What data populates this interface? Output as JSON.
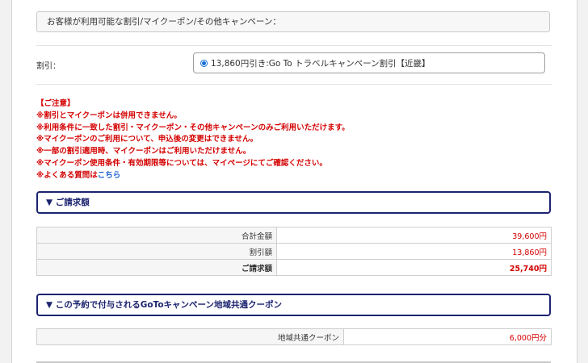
{
  "campaign_header": "お客様が利用可能な割引/マイクーポン/その他キャンペーン：",
  "discount": {
    "label": "割引：",
    "selected_option": "13,860円引き:Go To トラベルキャンペーン割引【近畿】"
  },
  "notes": {
    "title": "【ご注意】",
    "lines": [
      "※割引とマイクーポンは併用できません。",
      "※利用条件に一致した割引・マイクーポン・その他キャンペーンのみご利用いただけます。",
      "※マイクーポンのご利用について、申込後の変更はできません。",
      "※一部の割引適用時、マイクーポンはご利用いただけません。",
      "※マイクーポン使用条件・有効期限等については、マイページにてご確認ください。"
    ],
    "faq_prefix": "※よくある質問は",
    "faq_link": "こちら"
  },
  "billing": {
    "header": "▼ ご請求額",
    "rows": [
      {
        "label": "合計金額",
        "value": "39,600円"
      },
      {
        "label": "割引額",
        "value": "13,860円"
      },
      {
        "label": "ご請求額",
        "value": "25,740円"
      }
    ]
  },
  "coupon": {
    "header": "▼ この予約で付与されるGoToキャンペーン地域共通クーポン",
    "label": "地域共通クーポン",
    "value": "6,000円分"
  },
  "colors": {
    "accent_navy": "#1c2470",
    "warning_red": "#d40000",
    "link_blue": "#1a5fd0"
  }
}
